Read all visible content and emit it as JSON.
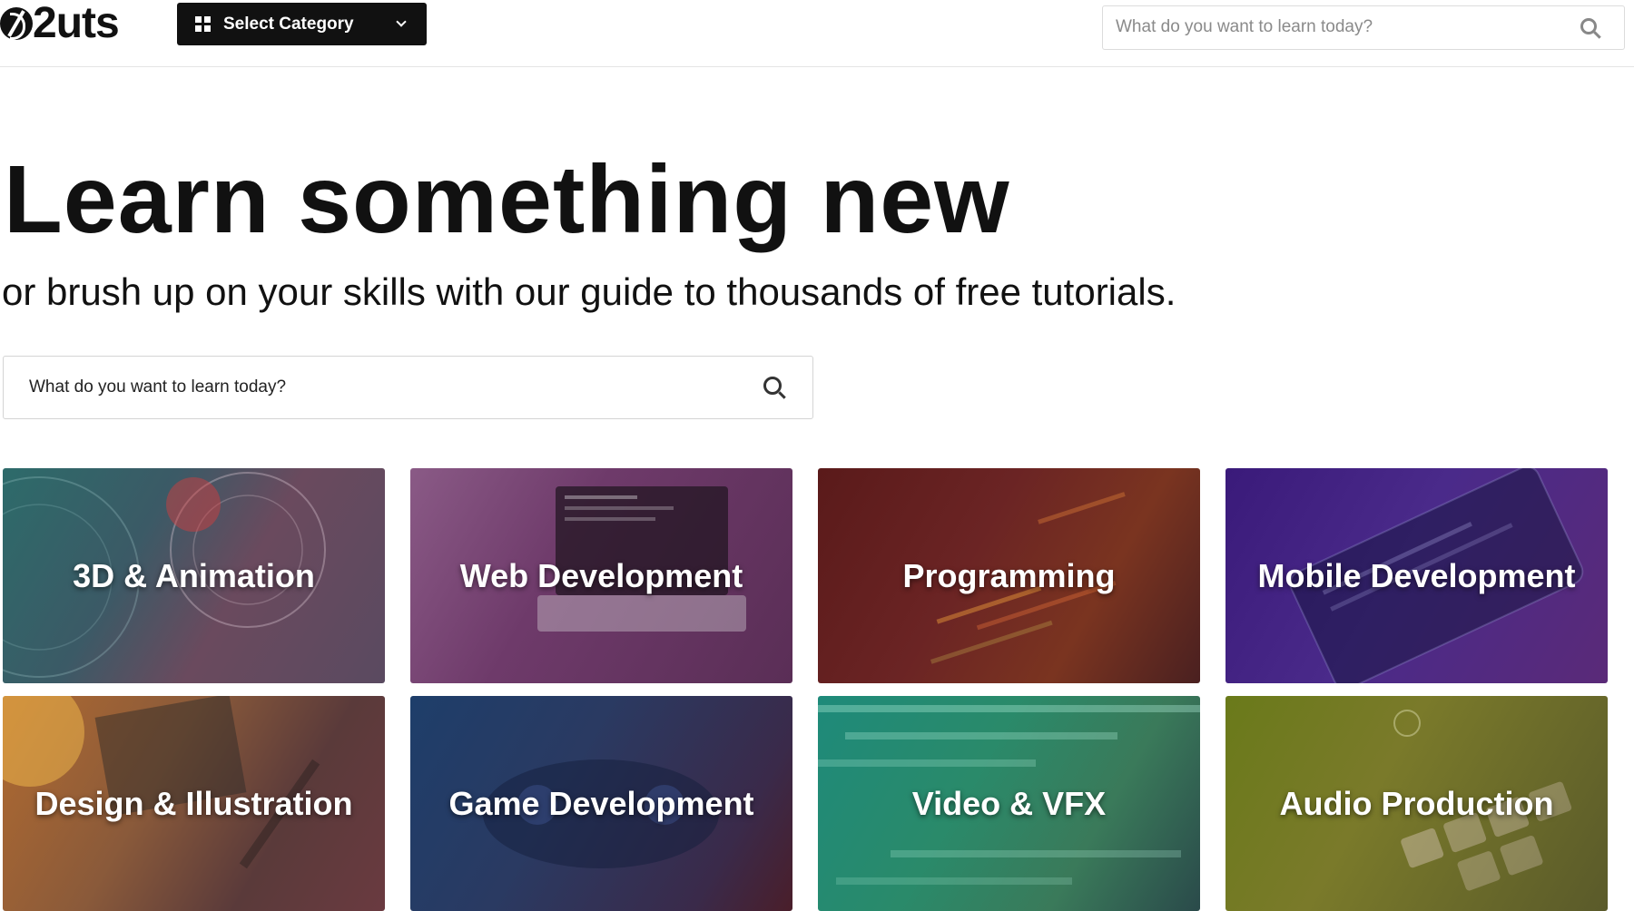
{
  "header": {
    "logo_text": "2uts",
    "category_button_label": "Select Category",
    "search_placeholder": "What do you want to learn today?"
  },
  "hero": {
    "title": "Learn something new",
    "subtitle": "or brush up on your skills with our guide to thousands of free tutorials.",
    "search_placeholder": "What do you want to learn today?"
  },
  "categories": [
    {
      "label": "3D & Animation"
    },
    {
      "label": "Web Development"
    },
    {
      "label": "Programming"
    },
    {
      "label": "Mobile Development"
    },
    {
      "label": "Design & Illustration"
    },
    {
      "label": "Game Development"
    },
    {
      "label": "Video & VFX"
    },
    {
      "label": "Audio Production"
    }
  ],
  "colors": {
    "header_button_bg": "#111111",
    "text": "#111111",
    "border": "#e4e4e4"
  }
}
